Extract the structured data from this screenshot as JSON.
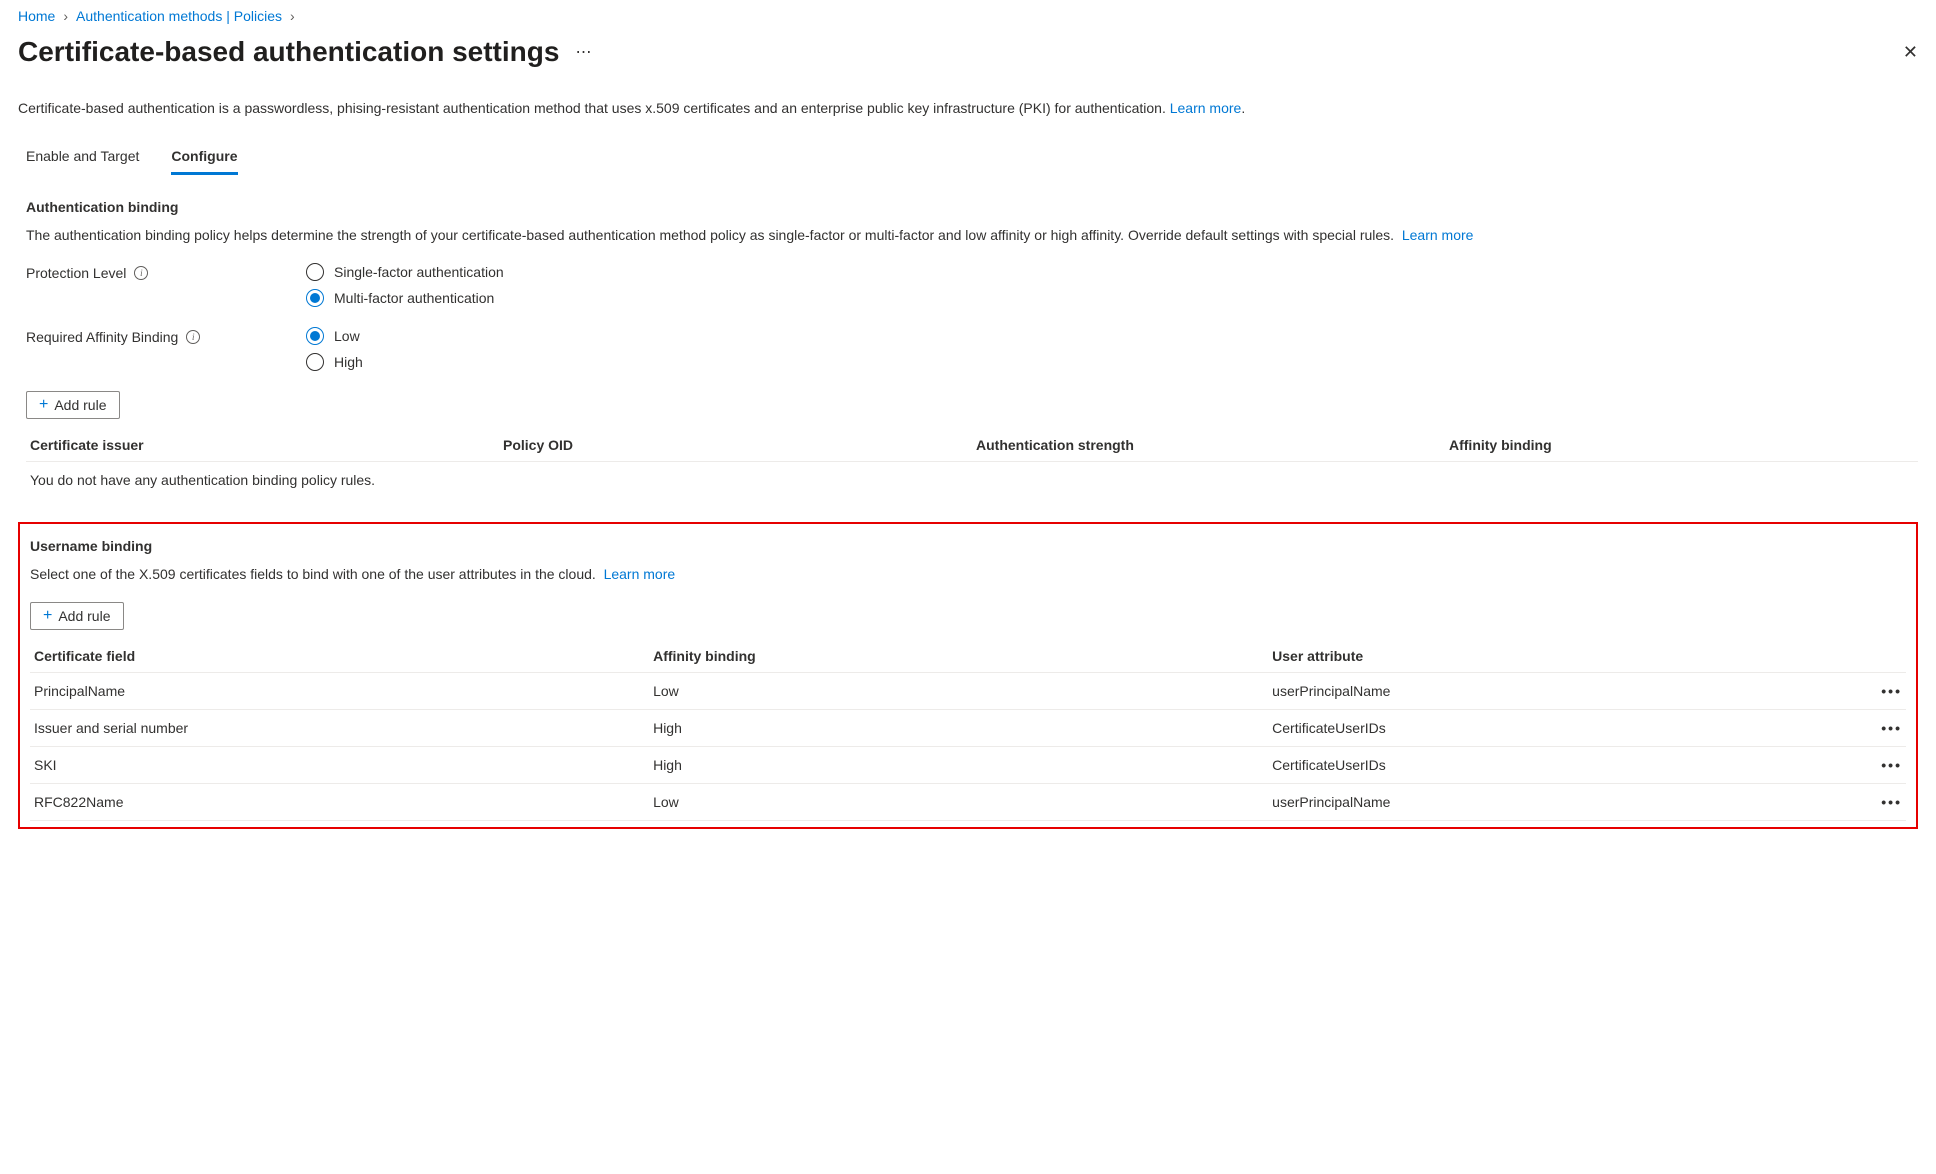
{
  "breadcrumb": {
    "home": "Home",
    "auth_methods": "Authentication methods | Policies"
  },
  "page_title": "Certificate-based authentication settings",
  "description": "Certificate-based authentication is a passwordless, phising-resistant authentication method that uses x.509 certificates and an enterprise public key infrastructure (PKI) for authentication.",
  "learn_more": "Learn more",
  "tabs": {
    "enable_target": "Enable and Target",
    "configure": "Configure"
  },
  "auth_binding": {
    "title": "Authentication binding",
    "desc": "The authentication binding policy helps determine the strength of your certificate-based authentication method policy as single-factor or multi-factor and low affinity or high affinity. Override default settings with special rules.",
    "protection_level_label": "Protection Level",
    "protection_options": {
      "single": "Single-factor authentication",
      "multi": "Multi-factor authentication"
    },
    "affinity_label": "Required Affinity Binding",
    "affinity_options": {
      "low": "Low",
      "high": "High"
    },
    "add_rule": "Add rule",
    "columns": {
      "issuer": "Certificate issuer",
      "oid": "Policy OID",
      "strength": "Authentication strength",
      "affinity": "Affinity binding"
    },
    "empty": "You do not have any authentication binding policy rules."
  },
  "username_binding": {
    "title": "Username binding",
    "desc": "Select one of the X.509 certificates fields to bind with one of the user attributes in the cloud.",
    "add_rule": "Add rule",
    "columns": {
      "field": "Certificate field",
      "affinity": "Affinity binding",
      "user_attr": "User attribute"
    },
    "rows": [
      {
        "field": "PrincipalName",
        "affinity": "Low",
        "user_attr": "userPrincipalName"
      },
      {
        "field": "Issuer and serial number",
        "affinity": "High",
        "user_attr": "CertificateUserIDs"
      },
      {
        "field": "SKI",
        "affinity": "High",
        "user_attr": "CertificateUserIDs"
      },
      {
        "field": "RFC822Name",
        "affinity": "Low",
        "user_attr": "userPrincipalName"
      }
    ]
  }
}
